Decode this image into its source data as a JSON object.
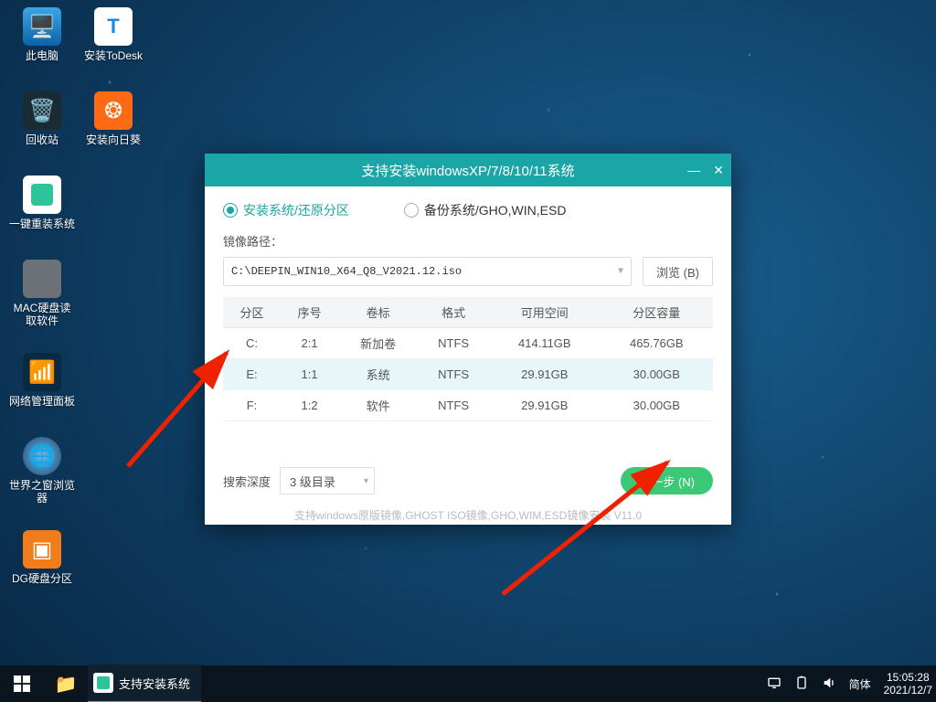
{
  "desktop_icons": [
    {
      "label": "此电脑"
    },
    {
      "label": "安装ToDesk"
    },
    {
      "label": "回收站"
    },
    {
      "label": "安装向日葵"
    },
    {
      "label": "一键重装系统"
    },
    {
      "label": "MAC硬盘读\n取软件"
    },
    {
      "label": "网络管理面板"
    },
    {
      "label": "世界之窗浏览\n器"
    },
    {
      "label": "DG硬盘分区"
    }
  ],
  "window": {
    "title": "支持安装windowsXP/7/8/10/11系统",
    "radio_install": "安装系统/还原分区",
    "radio_backup": "备份系统/GHO,WIN,ESD",
    "path_label": "镜像路径：",
    "path_value": "C:\\DEEPIN_WIN10_X64_Q8_V2021.12.iso",
    "browse": "浏览 (B)",
    "cols": {
      "c0": "分区",
      "c1": "序号",
      "c2": "卷标",
      "c3": "格式",
      "c4": "可用空间",
      "c5": "分区容量"
    },
    "rows": [
      {
        "p": "C:",
        "n": "2:1",
        "v": "新加卷",
        "f": "NTFS",
        "free": "414.11GB",
        "cap": "465.76GB"
      },
      {
        "p": "E:",
        "n": "1:1",
        "v": "系统",
        "f": "NTFS",
        "free": "29.91GB",
        "cap": "30.00GB"
      },
      {
        "p": "F:",
        "n": "1:2",
        "v": "软件",
        "f": "NTFS",
        "free": "29.91GB",
        "cap": "30.00GB"
      }
    ],
    "depth_label": "搜索深度",
    "depth_value": "3 级目录",
    "next": "下一步 (N)",
    "footer": "支持windows原版镜像,GHOST ISO镜像,GHO,WIM,ESD镜像安装 V11.0"
  },
  "taskbar": {
    "task_label": "支持安装系统",
    "ime": "简体",
    "time": "15:05:28",
    "date": "2021/12/7"
  }
}
